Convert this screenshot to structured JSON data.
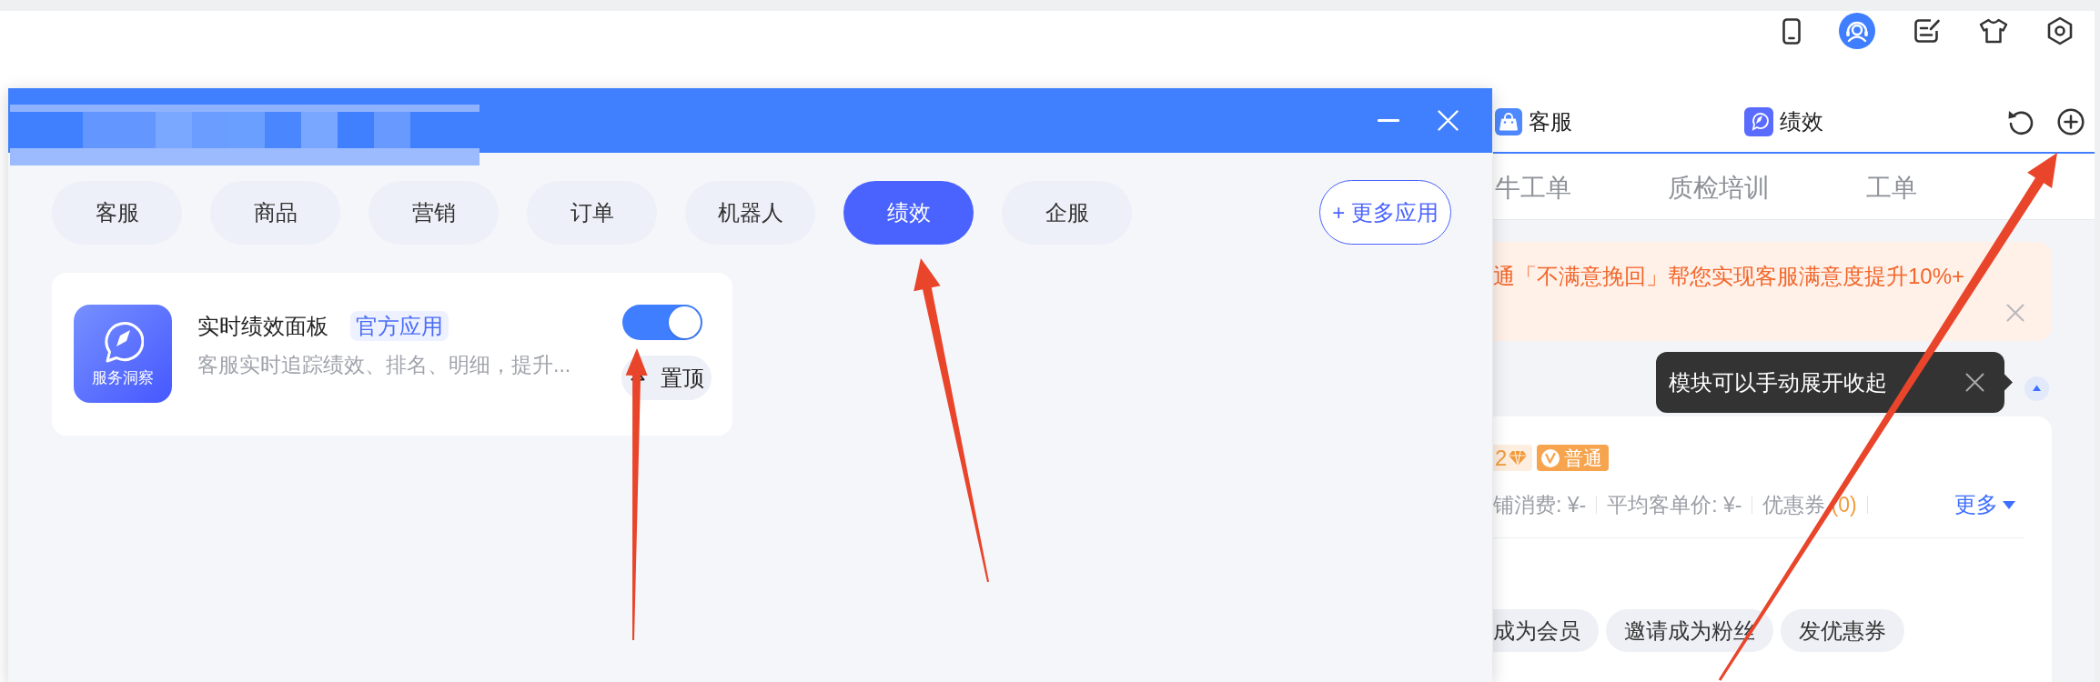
{
  "top_bar": {
    "buttons": [
      {
        "kind": "phone",
        "selected": false
      },
      {
        "kind": "headset",
        "selected": true
      },
      {
        "kind": "note",
        "selected": false
      },
      {
        "kind": "shirt",
        "selected": false
      },
      {
        "kind": "settings",
        "selected": false
      }
    ]
  },
  "modal": {
    "categories": [
      {
        "label": "客服",
        "selected": false
      },
      {
        "label": "商品",
        "selected": false
      },
      {
        "label": "营销",
        "selected": false
      },
      {
        "label": "订单",
        "selected": false
      },
      {
        "label": "机器人",
        "selected": false
      },
      {
        "label": "绩效",
        "selected": true
      },
      {
        "label": "企服",
        "selected": false
      }
    ],
    "more_button": "+ 更多应用",
    "apps": [
      {
        "icon_caption": "服务洞察",
        "name": "实时绩效面板",
        "badge": "官方应用",
        "description": "客服实时追踪绩效、排名、明细，提升...",
        "on": true,
        "pin_label": "置顶"
      }
    ]
  },
  "panel": {
    "tabs": [
      {
        "kind": "bag",
        "label": "客服"
      },
      {
        "kind": "compass",
        "label": "绩效"
      }
    ],
    "subtabs": [
      "牛工单",
      "质检培训",
      "工单"
    ],
    "banner": {
      "text": "通「不满意挽回」帮您实现客服满意度提升10%+"
    },
    "tooltip": "模块可以手动展开收起",
    "customer_card": {
      "tags": [
        {
          "kind": "diamond",
          "text": "2"
        },
        {
          "kind": "member",
          "text": "普通"
        }
      ],
      "stats": [
        {
          "label": "铺消费: ¥-"
        },
        {
          "label": "平均客单价: ¥-"
        },
        {
          "label": "优惠券",
          "count": "(0)"
        }
      ],
      "more_link": "更多",
      "actions": [
        "成为会员",
        "邀请成为粉丝",
        "发优惠券"
      ]
    }
  }
}
